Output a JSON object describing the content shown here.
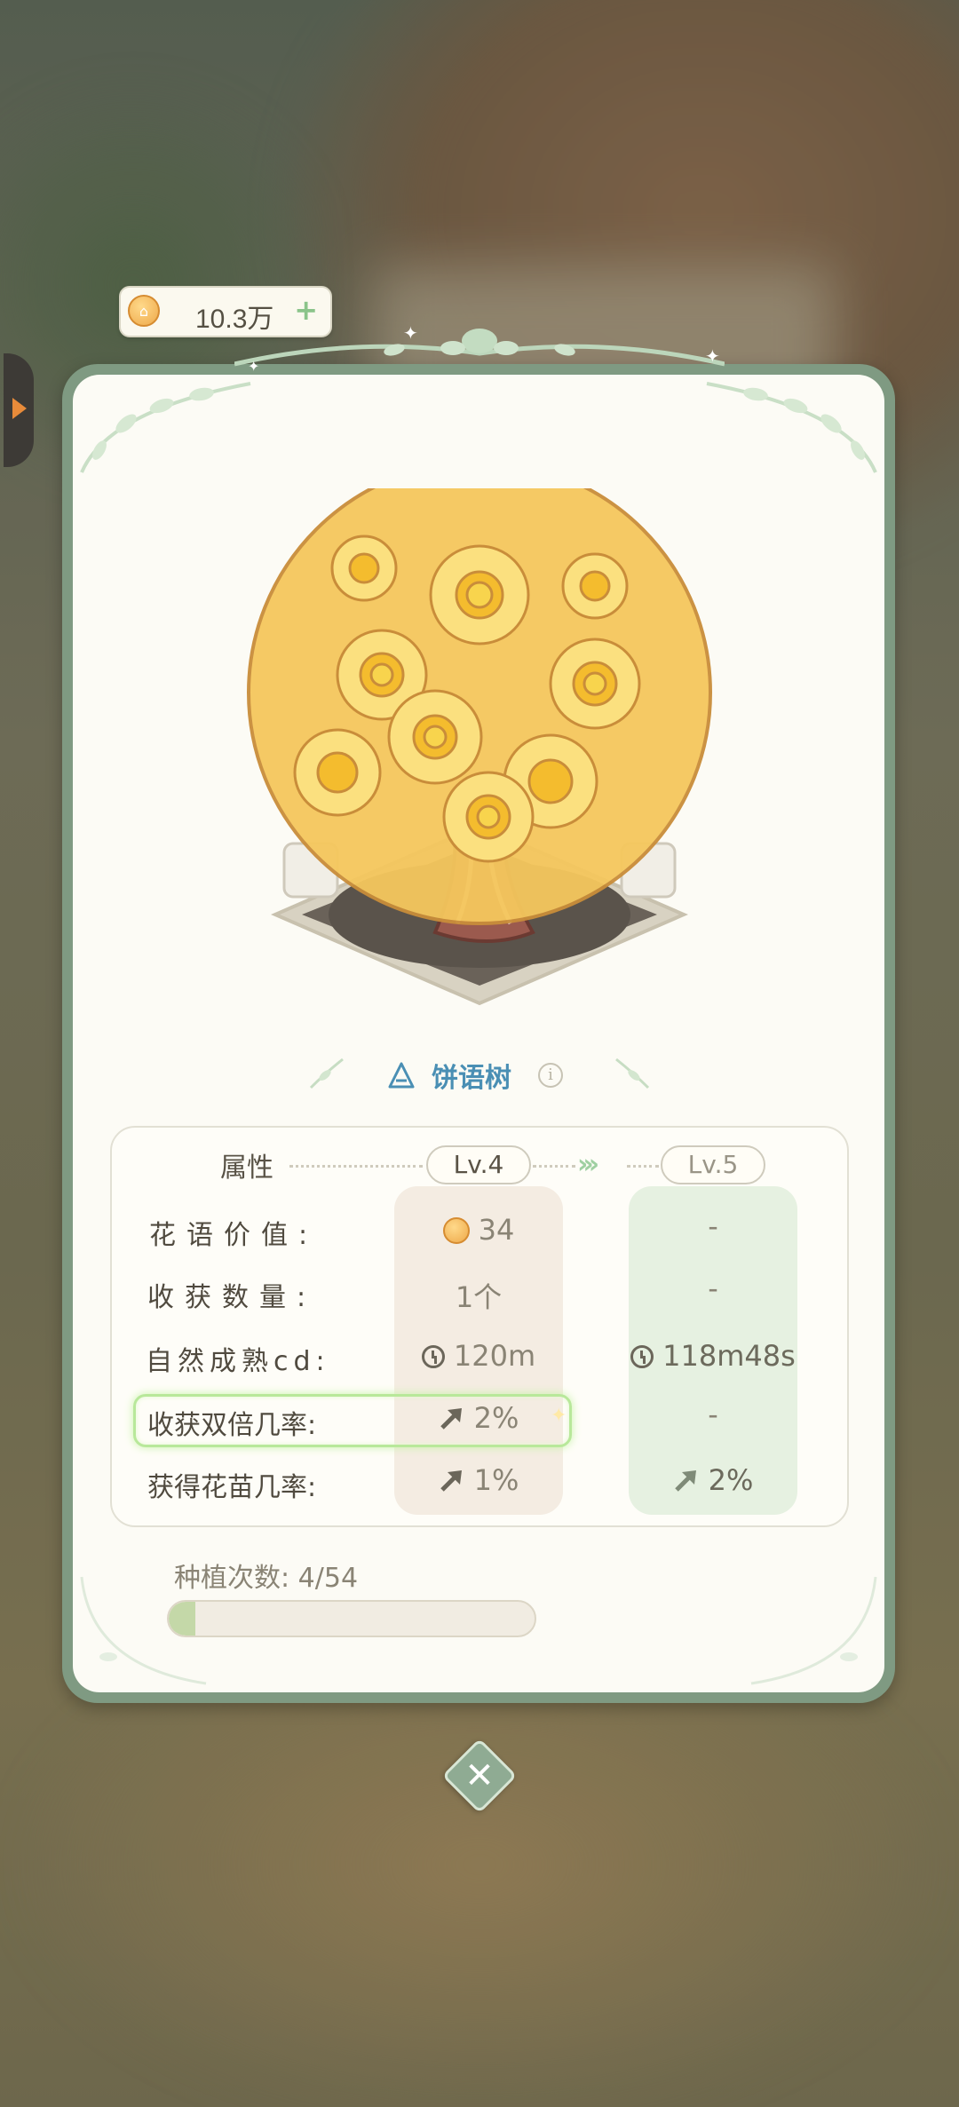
{
  "currency": {
    "amount": "10.3万",
    "plus": "+"
  },
  "plant": {
    "name": "饼语树",
    "info": "i"
  },
  "attributes": {
    "title": "属性",
    "current_level": "Lv.4",
    "next_level": "Lv.5",
    "rows": [
      {
        "label": "花语价值:",
        "current": "34",
        "next": "-"
      },
      {
        "label": "收获数量:",
        "current": "1个",
        "next": "-"
      },
      {
        "label": "自然成熟cd:",
        "current": "120m",
        "next": "118m48s"
      },
      {
        "label": "收获双倍几率:",
        "current": "2%",
        "next": "-"
      },
      {
        "label": "获得花苗几率:",
        "current": "1%",
        "next": "2%"
      }
    ]
  },
  "planting": {
    "label": "种植次数:",
    "value": "4/54",
    "progress": 0.074
  },
  "colors": {
    "frame": "#7f9a82",
    "accent_blue": "#4a8fb4",
    "highlight": "#b8e89a",
    "progress": "#c4d8a8"
  },
  "icons": [
    "coin-icon",
    "plus-icon",
    "side-arrow-icon",
    "plant-type-icon",
    "info-icon",
    "clock-icon",
    "up-arrow-icon",
    "close-icon"
  ]
}
